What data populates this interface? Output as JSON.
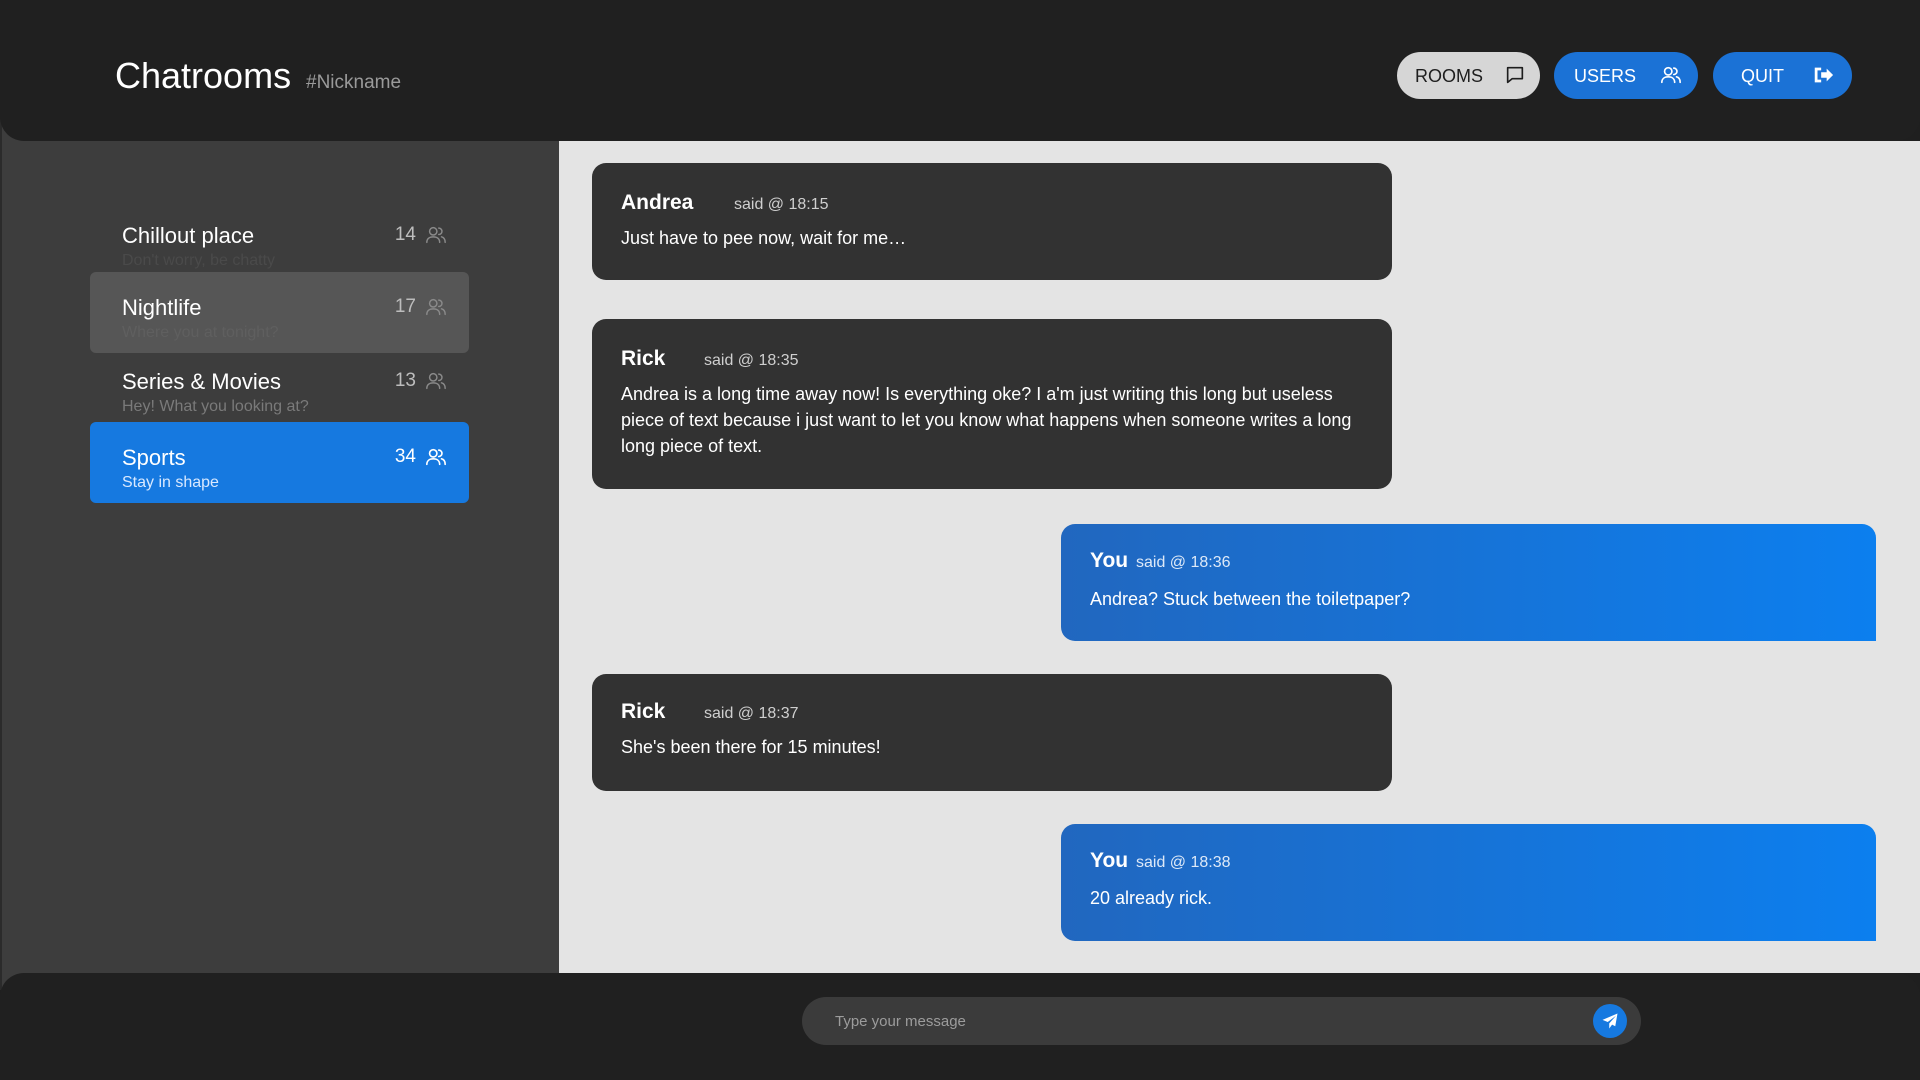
{
  "header": {
    "title": "Chatrooms",
    "nickname": "#Nickname",
    "buttons": {
      "rooms": "ROOMS",
      "users": "USERS",
      "quit": "QUIT"
    }
  },
  "icons": {
    "rooms": "chat-bubble-icon",
    "users": "users-icon",
    "quit": "sign-out-icon",
    "send": "paper-plane-icon"
  },
  "colors": {
    "accent": "#1679e0",
    "header_bg": "#202020",
    "sidebar_bg": "#3d3d3d",
    "chat_bg": "#e4e4e4",
    "bubble_other": "#323232"
  },
  "rooms": [
    {
      "name": "Chillout place",
      "description": "Don't worry, be chatty",
      "count": "14",
      "state": "normal"
    },
    {
      "name": "Nightlife",
      "description": "Where you at tonight?",
      "count": "17",
      "state": "hover"
    },
    {
      "name": "Series & Movies",
      "description": "Hey! What you looking at?",
      "count": "13",
      "state": "normal"
    },
    {
      "name": "Sports",
      "description": "Stay in shape",
      "count": "34",
      "state": "active"
    }
  ],
  "messages": [
    {
      "author": "Andrea",
      "meta": "said @ 18:15",
      "text": "Just have to pee now, wait for me…",
      "mine": false
    },
    {
      "author": "Rick",
      "meta": "said @ 18:35",
      "text": "Andrea is a long time away now! Is everything oke? I a'm just writing this long but useless piece of text because i just want to let you know what happens when someone writes a long long piece of text.",
      "mine": false
    },
    {
      "author": "You",
      "meta": "said @ 18:36",
      "text": "Andrea? Stuck between the toiletpaper?",
      "mine": true
    },
    {
      "author": "Rick",
      "meta": "said @ 18:37",
      "text": "She's been there for 15 minutes!",
      "mine": false
    },
    {
      "author": "You",
      "meta": "said @ 18:38",
      "text": "20 already rick.",
      "mine": true
    }
  ],
  "composer": {
    "placeholder": "Type your message",
    "value": ""
  }
}
